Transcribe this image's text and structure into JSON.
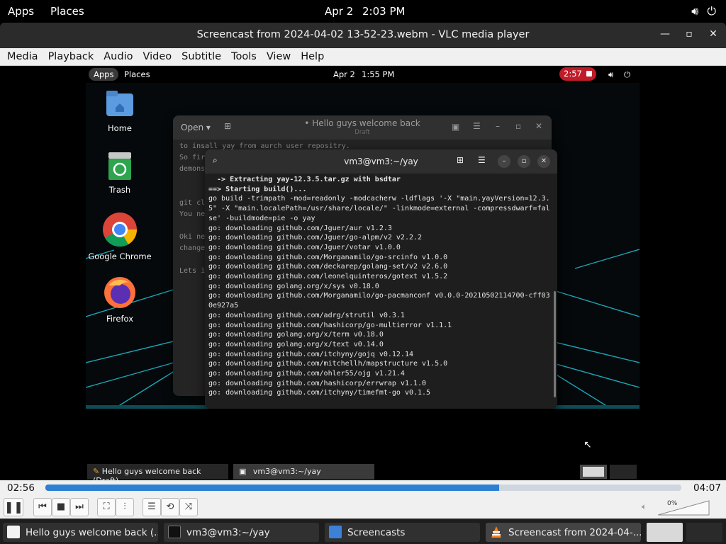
{
  "topbar": {
    "apps": "Apps",
    "places": "Places",
    "date": "Apr 2",
    "time": "2:03 PM"
  },
  "vlc": {
    "title": "Screencast from 2024-04-02 13-52-23.webm - VLC media player",
    "menu": [
      "Media",
      "Playback",
      "Audio",
      "Video",
      "Subtitle",
      "Tools",
      "View",
      "Help"
    ],
    "elapsed": "02:56",
    "total": "04:07",
    "progress": 0.713,
    "volume_percent": "0%"
  },
  "inner": {
    "topbar": {
      "apps": "Apps",
      "places": "Places",
      "date": "Apr 2",
      "time": "1:55 PM",
      "rec_time": "2:57"
    },
    "desktop_icons": [
      {
        "label": "Home"
      },
      {
        "label": "Trash"
      },
      {
        "label": "Google Chrome"
      },
      {
        "label": "Firefox"
      }
    ],
    "editor": {
      "open_label": "Open",
      "title": "• Hello guys welcome back",
      "subtitle": "Draft",
      "lines": [
        "to insall yay from aurch user repositry.",
        "So first",
        "demons",
        "",
        "",
        "git cl",
        "You ne",
        "",
        "Oki ne",
        "change",
        "",
        "Lets i"
      ]
    },
    "terminal": {
      "title": "vm3@vm3:~/yay",
      "lines": [
        "  -> Extracting yay-12.3.5.tar.gz with bsdtar",
        "==> Starting build()...",
        "go build -trimpath -mod=readonly -modcacherw -ldflags '-X \"main.yayVersion=12.3.",
        "5\" -X \"main.localePath=/usr/share/locale/\" -linkmode=external -compressdwarf=fal",
        "se' -buildmode=pie -o yay",
        "go: downloading github.com/Jguer/aur v1.2.3",
        "go: downloading github.com/Jguer/go-alpm/v2 v2.2.2",
        "go: downloading github.com/Jguer/votar v1.0.0",
        "go: downloading github.com/Morganamilo/go-srcinfo v1.0.0",
        "go: downloading github.com/deckarep/golang-set/v2 v2.6.0",
        "go: downloading github.com/leonelquinteros/gotext v1.5.2",
        "go: downloading golang.org/x/sys v0.18.0",
        "go: downloading github.com/Morganamilo/go-pacmanconf v0.0.0-20210502114700-cff03",
        "0e927a5",
        "go: downloading github.com/adrg/strutil v0.3.1",
        "go: downloading github.com/hashicorp/go-multierror v1.1.1",
        "go: downloading golang.org/x/term v0.18.0",
        "go: downloading golang.org/x/text v0.14.0",
        "go: downloading github.com/itchyny/gojq v0.12.14",
        "go: downloading github.com/mitchellh/mapstructure v1.5.0",
        "go: downloading github.com/ohler55/ojg v1.21.4",
        "go: downloading github.com/hashicorp/errwrap v1.1.0",
        "go: downloading github.com/itchyny/timefmt-go v0.1.5"
      ]
    },
    "taskbar": [
      "Hello guys welcome back (Draft) - ...",
      "vm3@vm3:~/yay"
    ]
  },
  "taskbar": {
    "items": [
      {
        "label": "Hello guys welcome back (...",
        "icon": "text-editor-icon"
      },
      {
        "label": "vm3@vm3:~/yay",
        "icon": "terminal-icon"
      },
      {
        "label": "Screencasts",
        "icon": "files-icon"
      },
      {
        "label": "Screencast from 2024-04-...",
        "icon": "vlc-icon"
      }
    ]
  }
}
